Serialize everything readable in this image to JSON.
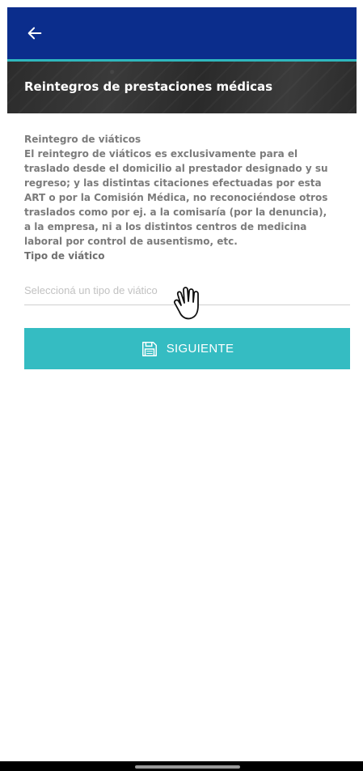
{
  "header": {
    "back_icon": "arrow-left-icon",
    "title": "Reintegros de prestaciones médicas"
  },
  "info": {
    "title": "Reintegro de viáticos",
    "body": "El reintegro de viáticos es exclusivamente para el traslado desde el domicilio al prestador designado y su regreso; y las distintas citaciones efectuadas por esta ART o por la Comisión Médica, no reconociéndose otros traslados como por ej. a la comisaría (por la denuncia), a la empresa, ni a los distintos centros de medicina laboral por control de ausentismo, etc."
  },
  "form": {
    "field_label": "Tipo de viático",
    "select_placeholder": "Seleccioná un tipo de viático"
  },
  "actions": {
    "next_label": "SIGUIENTE",
    "next_icon": "save-icon"
  },
  "colors": {
    "app_bar": "#0b2d8c",
    "accent": "#35bcc2",
    "banner": "#2f2f2f"
  }
}
